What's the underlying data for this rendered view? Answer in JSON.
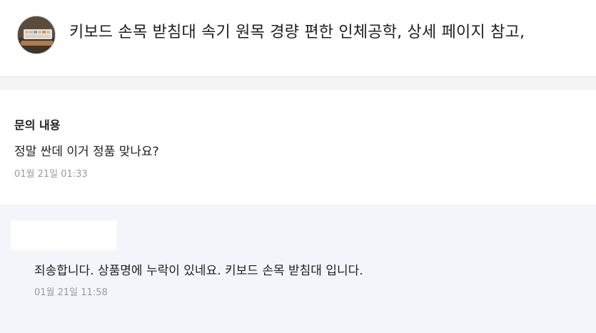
{
  "product": {
    "thumbnail": "keyboard-wrist-rest-thumbnail",
    "title": "키보드 손목 받침대 속기 원목 경량 편한 인체공학, 상세 페이지 참고,"
  },
  "question": {
    "label": "문의 내용",
    "text": "정말 싼데 이거 정품 맞나요?",
    "timestamp": "01월 21일 01:33"
  },
  "answer": {
    "text": "죄송합니다. 상품명에 누락이 있네요. 키보드 손목 받침대 입니다.",
    "timestamp": "01월 21일 11:58"
  },
  "colors": {
    "page_background": "#f4f4f6",
    "answer_background": "#f3f5fb",
    "timestamp_text": "#9a9a9a"
  }
}
